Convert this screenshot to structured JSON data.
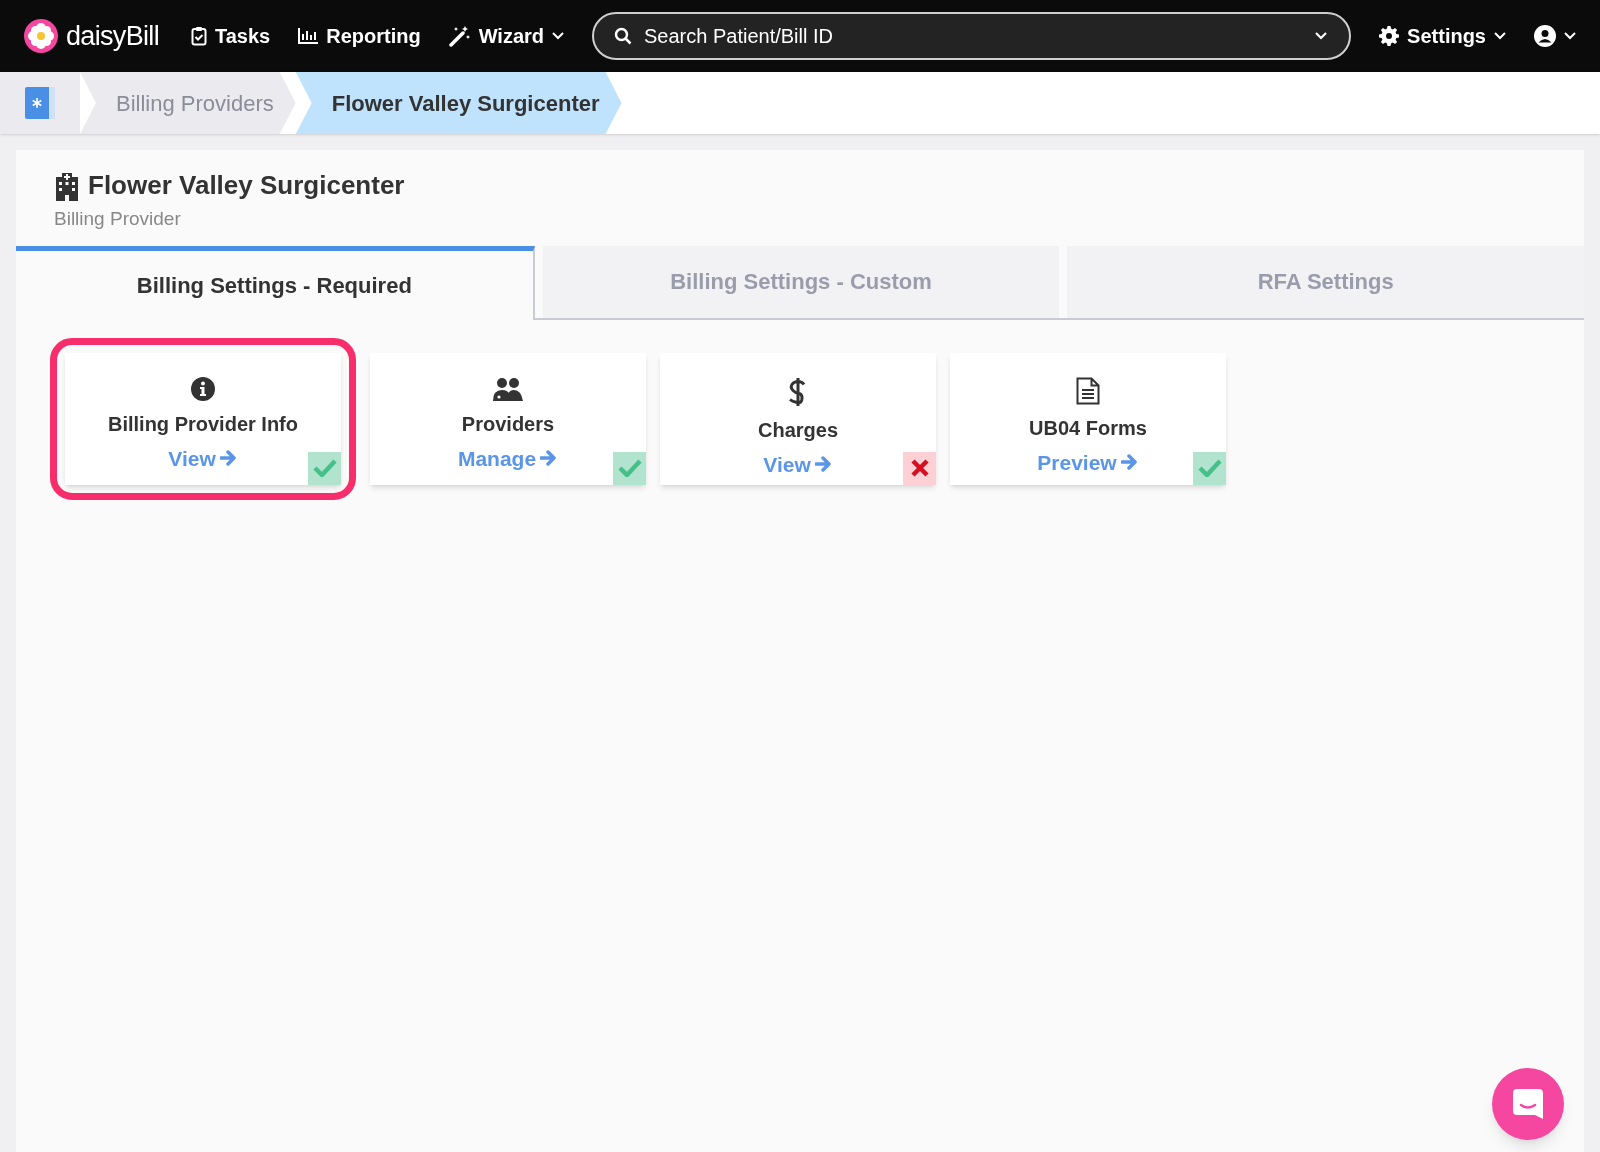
{
  "navbar": {
    "logo": "daisyBill",
    "items": [
      {
        "kind": "tasks",
        "label": "Tasks"
      },
      {
        "kind": "reporting",
        "label": "Reporting"
      },
      {
        "kind": "wizard",
        "label": "Wizard"
      }
    ],
    "search": {
      "placeholder": "Search Patient/Bill ID"
    },
    "settings": {
      "label": "Settings"
    }
  },
  "breadcrumb": [
    {
      "label": "Billing Providers",
      "selected": false
    },
    {
      "label": "Flower Valley Surgicenter",
      "selected": true
    }
  ],
  "header": {
    "title": "Flower Valley Surgicenter",
    "subtitle": "Billing Provider"
  },
  "tabs": [
    {
      "label": "Billing Settings - Required",
      "selected": true
    },
    {
      "label": "Billing Settings - Custom",
      "selected": false
    },
    {
      "label": "RFA Settings",
      "selected": false
    }
  ],
  "cards": [
    {
      "kind": "info",
      "title": "Billing Provider Info",
      "link": "View",
      "complete": true,
      "highlighted": true
    },
    {
      "kind": "providers",
      "title": "Providers",
      "link": "Manage",
      "complete": true,
      "highlighted": false
    },
    {
      "kind": "charges",
      "title": "Charges",
      "link": "View",
      "complete": false,
      "highlighted": false
    },
    {
      "kind": "forms",
      "title": "UB04 Forms",
      "link": "Preview",
      "complete": true,
      "highlighted": false
    }
  ]
}
